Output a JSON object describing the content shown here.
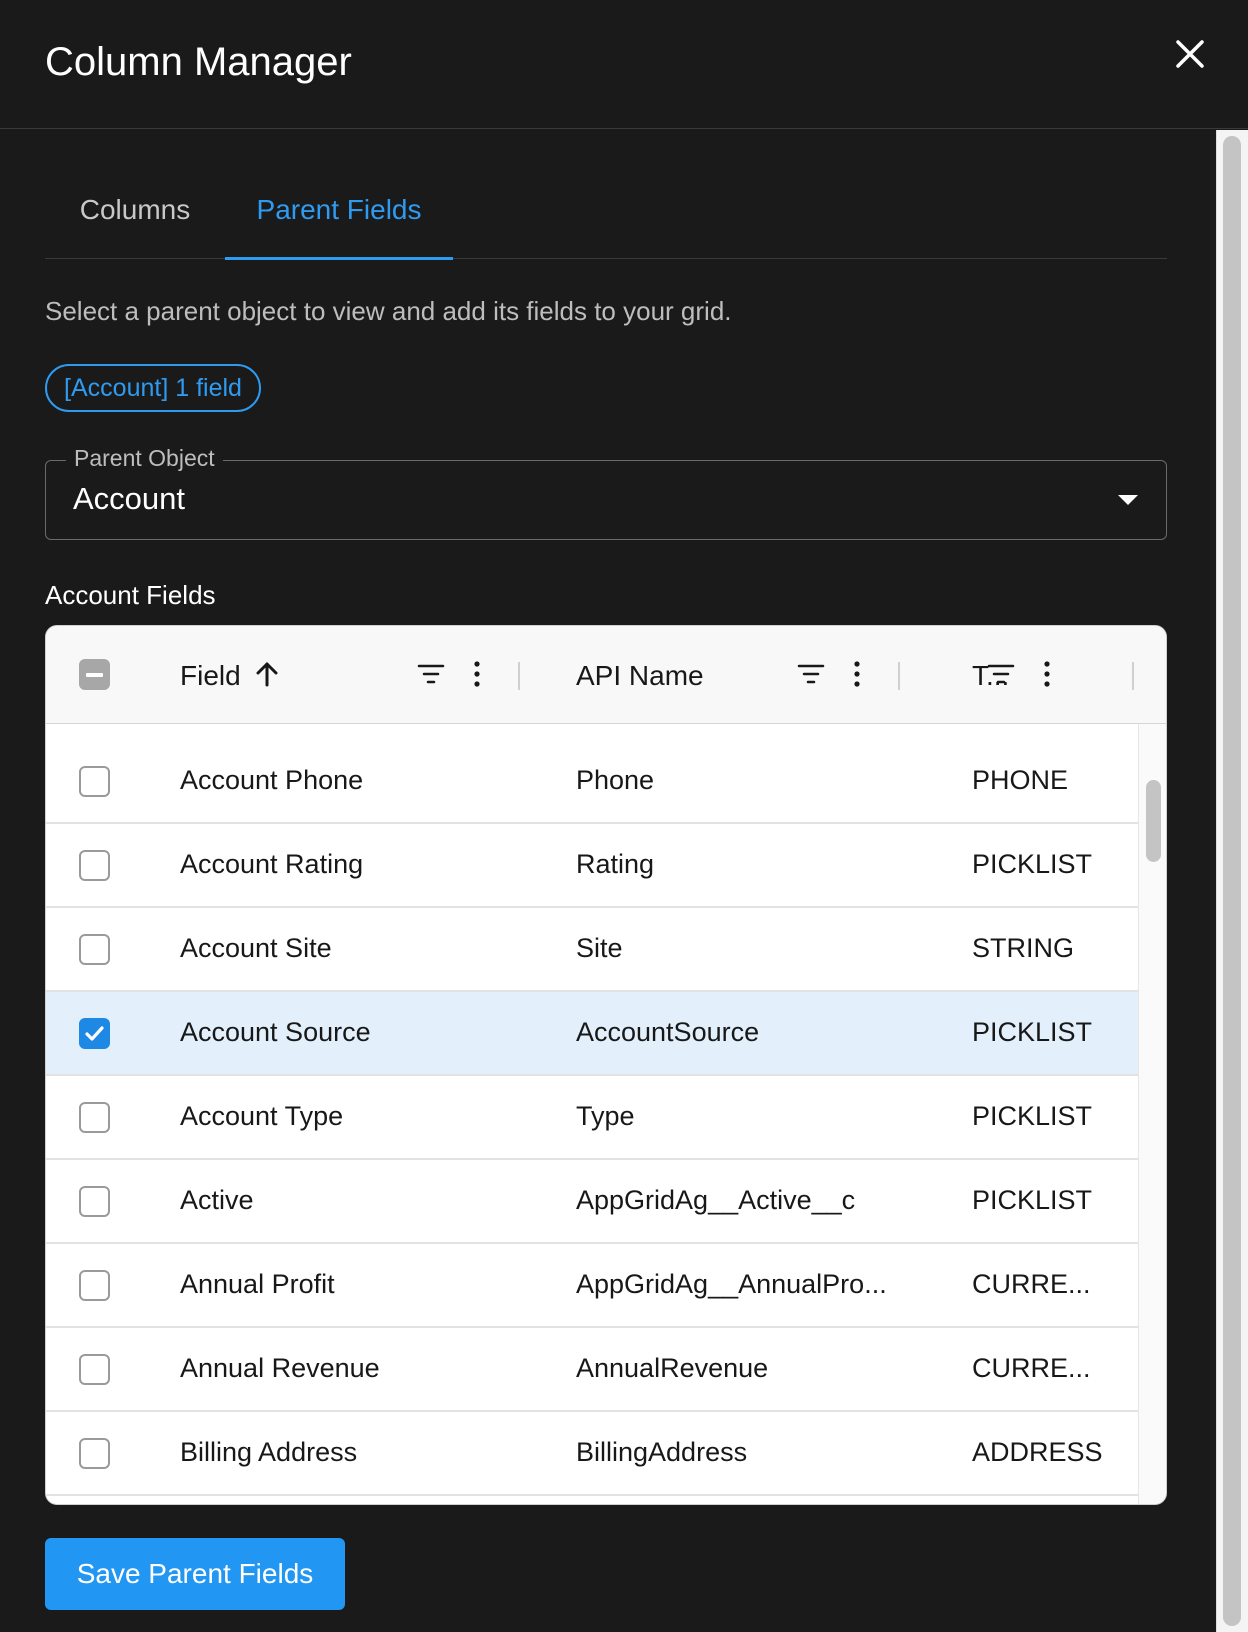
{
  "dialog": {
    "title": "Column Manager"
  },
  "tabs": [
    {
      "label": "Columns",
      "active": false
    },
    {
      "label": "Parent Fields",
      "active": true
    }
  ],
  "description": "Select a parent object to view and add its fields to your grid.",
  "chip": {
    "label": "[Account] 1 field"
  },
  "parent_select": {
    "legend": "Parent Object",
    "value": "Account"
  },
  "section_label": "Account Fields",
  "grid": {
    "columns": [
      {
        "label": "Field",
        "sorted": "asc"
      },
      {
        "label": "API Name"
      },
      {
        "label": "T..."
      }
    ],
    "rows": [
      {
        "field": "Account Phone",
        "api": "Phone",
        "type": "PHONE",
        "checked": false
      },
      {
        "field": "Account Rating",
        "api": "Rating",
        "type": "PICKLIST",
        "checked": false
      },
      {
        "field": "Account Site",
        "api": "Site",
        "type": "STRING",
        "checked": false
      },
      {
        "field": "Account Source",
        "api": "AccountSource",
        "type": "PICKLIST",
        "checked": true
      },
      {
        "field": "Account Type",
        "api": "Type",
        "type": "PICKLIST",
        "checked": false
      },
      {
        "field": "Active",
        "api": "AppGridAg__Active__c",
        "type": "PICKLIST",
        "checked": false
      },
      {
        "field": "Annual Profit",
        "api": "AppGridAg__AnnualPro...",
        "type": "CURRE...",
        "checked": false
      },
      {
        "field": "Annual Revenue",
        "api": "AnnualRevenue",
        "type": "CURRE...",
        "checked": false
      },
      {
        "field": "Billing Address",
        "api": "BillingAddress",
        "type": "ADDRESS",
        "checked": false
      }
    ]
  },
  "save_button": {
    "label": "Save Parent Fields"
  },
  "colors": {
    "background": "#1a1a1b",
    "accent": "#2196f3",
    "selected_row": "#e3f0fb"
  }
}
